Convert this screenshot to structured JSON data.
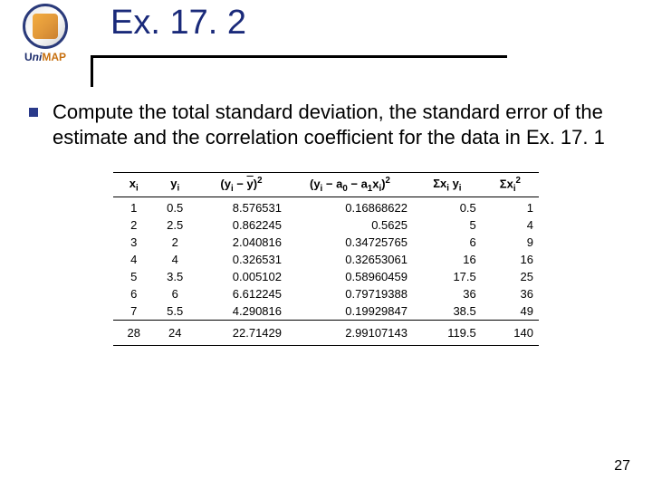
{
  "logo_text_1": "U",
  "logo_text_2": "ni",
  "logo_text_3": "MAP",
  "title": "Ex. 17. 2",
  "paragraph": "Compute the total standard deviation, the standard error of the estimate and the correlation coefficient for the data in Ex. 17. 1",
  "headers": {
    "h1": "x",
    "h1sub": "i",
    "h2": "y",
    "h2sub": "i",
    "h3a": "(y",
    "h3b": " − ",
    "h3c": "y",
    "h3d": ")",
    "h3sup": "2",
    "h4a": "(y",
    "h4b": " − a",
    "h4c": "0",
    "h4d": " − a",
    "h4e": "1",
    "h4f": "x",
    "h4g": ")",
    "h4sup": "2",
    "h5a": "Σx",
    "h5b": " y",
    "h6a": "Σx",
    "h6sup": "2"
  },
  "rows": [
    {
      "x": "1",
      "y": "0.5",
      "c3": "8.576531",
      "c4": "0.16868622",
      "c5": "0.5",
      "c6": "1"
    },
    {
      "x": "2",
      "y": "2.5",
      "c3": "0.862245",
      "c4": "0.5625",
      "c5": "5",
      "c6": "4"
    },
    {
      "x": "3",
      "y": "2",
      "c3": "2.040816",
      "c4": "0.34725765",
      "c5": "6",
      "c6": "9"
    },
    {
      "x": "4",
      "y": "4",
      "c3": "0.326531",
      "c4": "0.32653061",
      "c5": "16",
      "c6": "16"
    },
    {
      "x": "5",
      "y": "3.5",
      "c3": "0.005102",
      "c4": "0.58960459",
      "c5": "17.5",
      "c6": "25"
    },
    {
      "x": "6",
      "y": "6",
      "c3": "6.612245",
      "c4": "0.79719388",
      "c5": "36",
      "c6": "36"
    },
    {
      "x": "7",
      "y": "5.5",
      "c3": "4.290816",
      "c4": "0.19929847",
      "c5": "38.5",
      "c6": "49"
    }
  ],
  "sum": {
    "x": "28",
    "y": "24",
    "c3": "22.71429",
    "c4": "2.99107143",
    "c5": "119.5",
    "c6": "140"
  },
  "page_num": "27"
}
